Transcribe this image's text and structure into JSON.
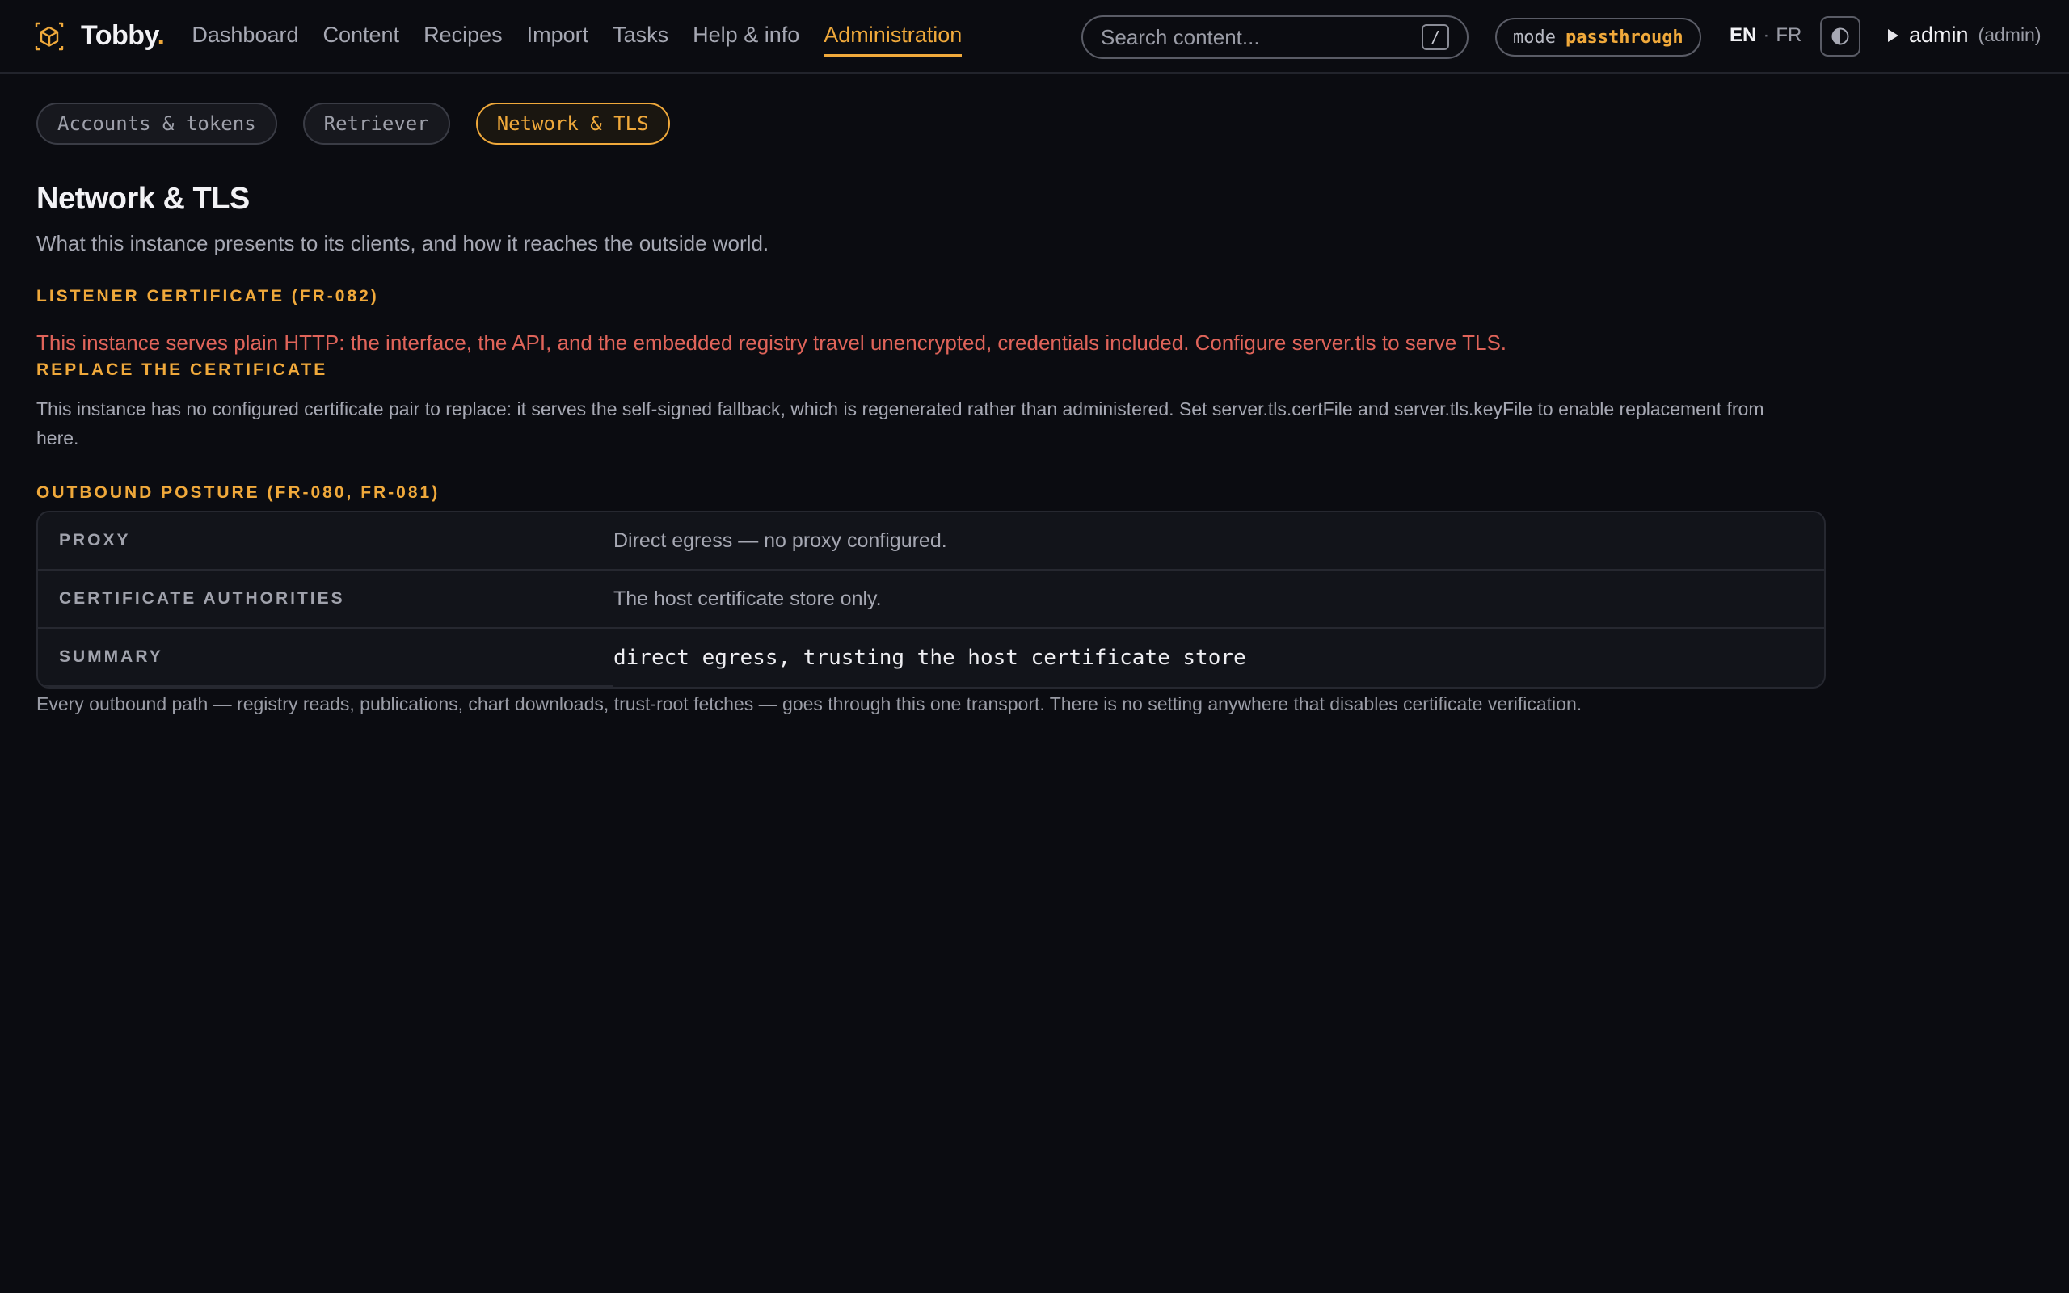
{
  "header": {
    "brand_name": "Tobby",
    "brand_dot": ".",
    "nav": [
      {
        "label": "Dashboard"
      },
      {
        "label": "Content"
      },
      {
        "label": "Recipes"
      },
      {
        "label": "Import"
      },
      {
        "label": "Tasks"
      },
      {
        "label": "Help & info"
      },
      {
        "label": "Administration"
      }
    ],
    "search_placeholder": "Search content...",
    "search_shortcut": "/",
    "mode_label": "mode",
    "mode_value": "passthrough",
    "lang_en": "EN",
    "lang_sep": "·",
    "lang_fr": "FR",
    "user_name": "admin",
    "user_role": "(admin)"
  },
  "subtabs": [
    {
      "label": "Accounts & tokens"
    },
    {
      "label": "Retriever"
    },
    {
      "label": "Network & TLS"
    }
  ],
  "page": {
    "title": "Network & TLS",
    "subtitle": "What this instance presents to its clients, and how it reaches the outside world."
  },
  "listener": {
    "heading": "LISTENER CERTIFICATE (FR-082)",
    "warning": "This instance serves plain HTTP: the interface, the API, and the embedded registry travel unencrypted, credentials included. Configure server.tls to serve TLS."
  },
  "replace": {
    "heading": "REPLACE THE CERTIFICATE",
    "text": "This instance has no configured certificate pair to replace: it serves the self-signed fallback, which is regenerated rather than administered. Set server.tls.certFile and server.tls.keyFile to enable replacement from here."
  },
  "outbound": {
    "heading": "OUTBOUND POSTURE (FR-080, FR-081)",
    "rows": [
      {
        "key": "PROXY",
        "value": "Direct egress — no proxy configured."
      },
      {
        "key": "CERTIFICATE AUTHORITIES",
        "value": "The host certificate store only."
      },
      {
        "key": "SUMMARY",
        "value": "direct egress, trusting the host certificate store"
      }
    ],
    "footnote": "Every outbound path — registry reads, publications, chart downloads, trust-root fetches — goes through this one transport. There is no setting anywhere that disables certificate verification."
  },
  "colors": {
    "accent": "#f0a93b",
    "warning": "#e0645a",
    "background": "#0b0c11"
  }
}
